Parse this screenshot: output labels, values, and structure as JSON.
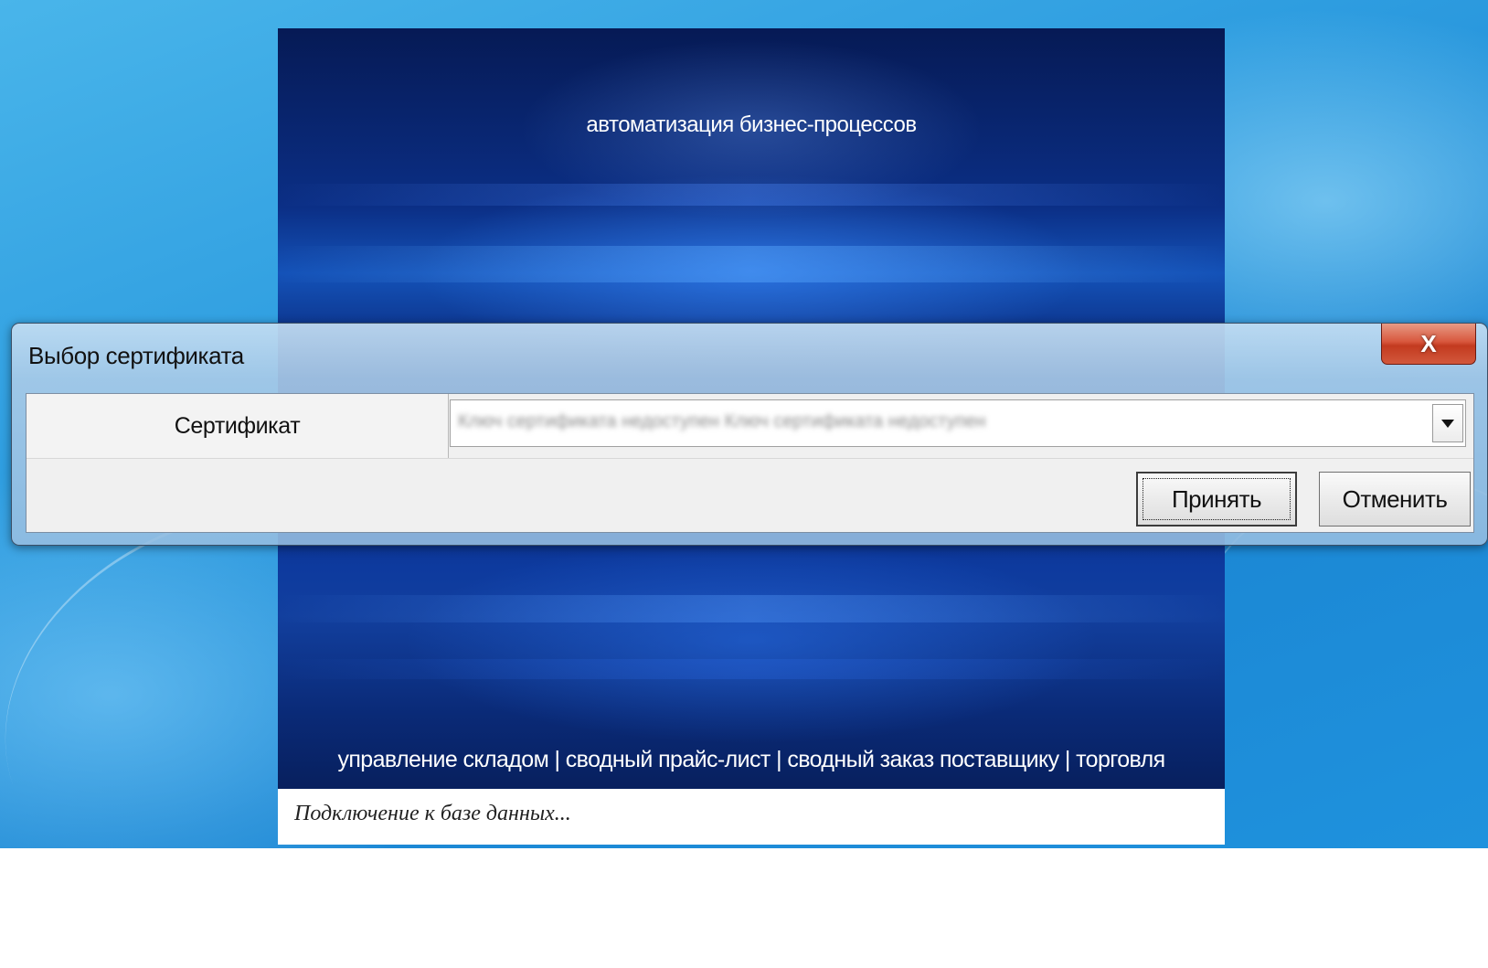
{
  "splash": {
    "tagline": "автоматизация бизнес-процессов",
    "features": "управление складом | сводный прайс-лист | сводный заказ поставщику | торговля",
    "status": "Подключение к базе данных..."
  },
  "dialog": {
    "title": "Выбор сертификата",
    "close_label": "X",
    "field_label": "Сертификат",
    "certificate_value": "Ключ сертификата недоступен Ключ сертификата недоступен",
    "accept_label": "Принять",
    "cancel_label": "Отменить"
  },
  "icons": {
    "close": "close-icon",
    "dropdown": "chevron-down-icon"
  },
  "colors": {
    "close_button": "#c33a1f",
    "splash_background": "#0b2f86",
    "desktop_background": "#2e9de0"
  }
}
